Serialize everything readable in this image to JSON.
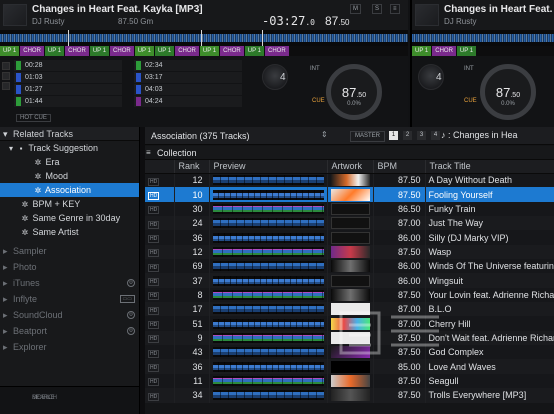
{
  "deck1": {
    "title": "Changes in Heart Feat. Kayka [MP3]",
    "artist": "DJ Rusty",
    "bpm_small": "87.50 Gm",
    "time": "-03:27",
    "time_tenths": ".0",
    "bpm_big": "87",
    "bpm_big_dec": ".50",
    "deck_number": "4",
    "platter_bpm": "87",
    "platter_bpm_dec": ".50",
    "platter_pitch": "0.0%",
    "hot_cue_label": "HOT CUE",
    "int_label": "INT",
    "cue_label": "CUE",
    "cue_markers": [
      "UP 1",
      "CHOR",
      "UP 1",
      "CHOR",
      "UP 1",
      "CHOR",
      "UP 1",
      "UP 1",
      "CHOR",
      "UP 1",
      "CHOR",
      "UP 1",
      "CHOR"
    ],
    "hot_cues_left": [
      {
        "time": "00:28",
        "color": "#2d9c3a"
      },
      {
        "time": "01:03",
        "color": "#2a54c8"
      },
      {
        "time": "01:27",
        "color": "#2a54c8"
      },
      {
        "time": "01:44",
        "color": "#2d9c3a"
      }
    ],
    "hot_cues_right": [
      {
        "time": "02:34",
        "color": "#2d9c3a"
      },
      {
        "time": "03:17",
        "color": "#2a54c8"
      },
      {
        "time": "04:03",
        "color": "#2a54c8"
      },
      {
        "time": "04:24",
        "color": "#7a2a8c"
      }
    ]
  },
  "deck2": {
    "title": "Changes in Heart Feat.",
    "artist": "DJ Rusty",
    "deck_number": "4",
    "platter_bpm": "87",
    "platter_bpm_dec": ".50",
    "platter_pitch": "0.0%",
    "cue_markers": [
      "UP 1",
      "CHOR",
      "UP 1"
    ]
  },
  "tree": {
    "header": "Related Tracks",
    "items": [
      {
        "label": "Track Suggestion",
        "icon": "folder-icon"
      },
      {
        "label": "Era",
        "icon": "gear-icon"
      },
      {
        "label": "Mood",
        "icon": "gear-icon"
      },
      {
        "label": "Association",
        "icon": "gear-icon"
      },
      {
        "label": "BPM + KEY",
        "icon": "gear-icon"
      },
      {
        "label": "Same Genre in 30day",
        "icon": "gear-icon"
      },
      {
        "label": "Same Artist",
        "icon": "gear-icon"
      }
    ],
    "sources": [
      "Sampler",
      "Photo",
      "iTunes",
      "Inflyte",
      "SoundCloud",
      "Beatport",
      "Explorer"
    ],
    "footer": [
      "SEARCH",
      "MOBILE"
    ]
  },
  "browser": {
    "list_title": "Association (375 Tracks)",
    "master_label": "MASTER",
    "pages": [
      "1",
      "2",
      "3",
      "4"
    ],
    "now_playing": "♪ : Changes in Hea",
    "collection_label": "Collection",
    "columns": [
      "Rank",
      "Preview",
      "Artwork",
      "BPM",
      "Track Title"
    ],
    "hd_label": "HD",
    "rows": [
      {
        "rank": "12",
        "bpm": "87.50",
        "title": "A Day Without Death",
        "pv": "pv-bar",
        "art": "a1"
      },
      {
        "rank": "10",
        "bpm": "87.50",
        "title": "Fooling Yourself",
        "pv": "pv-bar alt",
        "art": "a2"
      },
      {
        "rank": "30",
        "bpm": "86.50",
        "title": "Funky Train",
        "pv": "pv-bar c",
        "art": "a3"
      },
      {
        "rank": "24",
        "bpm": "87.00",
        "title": "Just The Way",
        "pv": "pv-bar",
        "art": "a3"
      },
      {
        "rank": "36",
        "bpm": "86.00",
        "title": "Silly (DJ Marky VIP)",
        "pv": "pv-bar alt",
        "art": "a3"
      },
      {
        "rank": "12",
        "bpm": "87.50",
        "title": "Wasp",
        "pv": "pv-bar c",
        "art": "a4"
      },
      {
        "rank": "69",
        "bpm": "86.00",
        "title": "Winds Of The Universe featuring",
        "pv": "pv-bar",
        "art": "a5"
      },
      {
        "rank": "37",
        "bpm": "86.00",
        "title": "Wingsuit",
        "pv": "pv-bar alt",
        "art": "a3"
      },
      {
        "rank": "8",
        "bpm": "87.50",
        "title": "Your Lovin feat. Adrienne Richar",
        "pv": "pv-bar c",
        "art": "a5"
      },
      {
        "rank": "17",
        "bpm": "87.00",
        "title": "B.L.O",
        "pv": "pv-bar",
        "art": "a7"
      },
      {
        "rank": "51",
        "bpm": "87.00",
        "title": "Cherry Hill",
        "pv": "pv-bar alt",
        "art": "a6"
      },
      {
        "rank": "9",
        "bpm": "87.50",
        "title": "Don't Wait feat. Adrienne Richar",
        "pv": "pv-bar c",
        "art": "a7"
      },
      {
        "rank": "43",
        "bpm": "87.50",
        "title": "God Complex",
        "pv": "pv-bar",
        "art": "a8"
      },
      {
        "rank": "36",
        "bpm": "85.00",
        "title": "Love And Waves",
        "pv": "pv-bar alt",
        "art": "a9"
      },
      {
        "rank": "11",
        "bpm": "87.50",
        "title": "Seagull",
        "pv": "pv-bar c",
        "art": "a10"
      },
      {
        "rank": "34",
        "bpm": "87.50",
        "title": "Trolls Everywhere [MP3]",
        "pv": "pv-bar",
        "art": "a11"
      }
    ],
    "selected_index": 1
  }
}
